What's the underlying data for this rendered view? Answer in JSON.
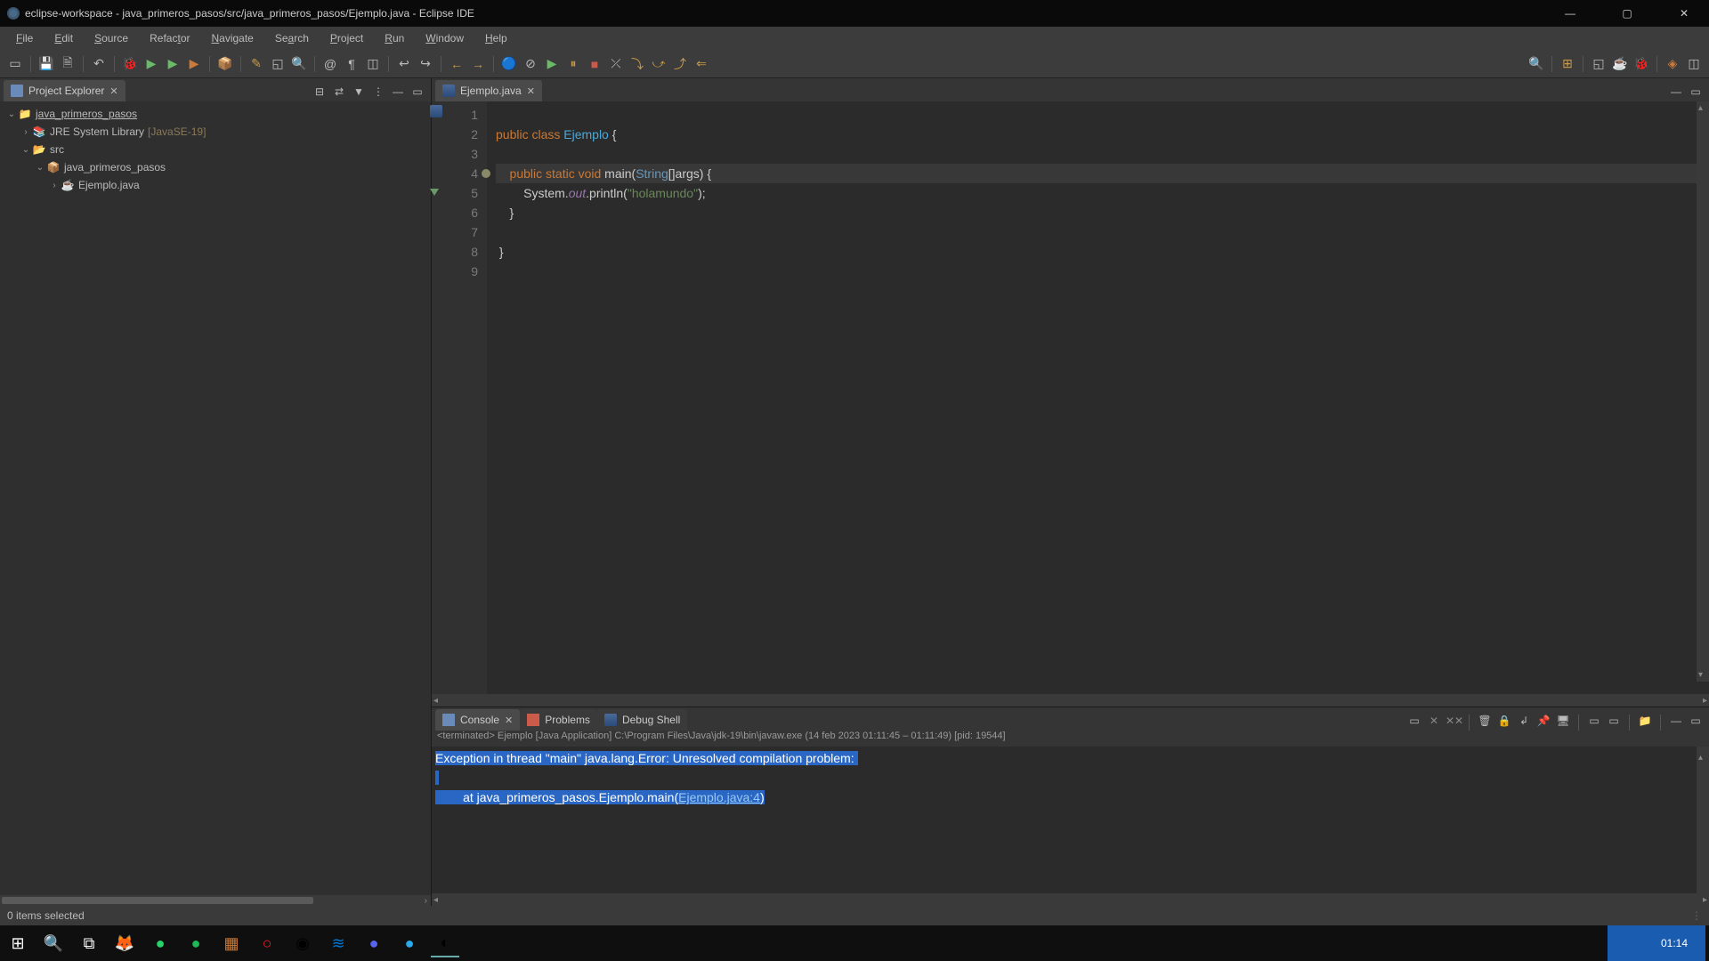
{
  "window_title": "eclipse-workspace - java_primeros_pasos/src/java_primeros_pasos/Ejemplo.java - Eclipse IDE",
  "menu": [
    "File",
    "Edit",
    "Source",
    "Refactor",
    "Navigate",
    "Search",
    "Project",
    "Run",
    "Window",
    "Help"
  ],
  "sidebar_tab": "Project Explorer",
  "tree": {
    "project": "java_primeros_pasos",
    "jre": "JRE System Library",
    "jre_ver": "[JavaSE-19]",
    "src": "src",
    "pkg": "java_primeros_pasos",
    "file": "Ejemplo.java"
  },
  "editor_tab": "Ejemplo.java",
  "code_lines": {
    "l1": "",
    "l2a": "public class ",
    "l2b": "Ejemplo",
    "l2c": " {",
    "l3": "",
    "l4a": "    public static void ",
    "l4b": "main",
    "l4c": "(",
    "l4d": "String",
    "l4e": "[]args) {",
    "l5a": "        System.",
    "l5b": "out",
    "l5c": ".println(",
    "l5d": "\"holamundo\"",
    "l5e": ");",
    "l6": "    }",
    "l7": "",
    "l8": " }",
    "l9": ""
  },
  "line_numbers": [
    "1",
    "2",
    "3",
    "4",
    "5",
    "6",
    "7",
    "8",
    "9"
  ],
  "console": {
    "tab1": "Console",
    "tab2": "Problems",
    "tab3": "Debug Shell",
    "status": "<terminated> Ejemplo [Java Application] C:\\Program Files\\Java\\jdk-19\\bin\\javaw.exe (14 feb 2023 01:11:45 – 01:11:49) [pid: 19544]",
    "line1": "Exception in thread \"main\" java.lang.Error: Unresolved compilation problem: ",
    "line2a": "        at java_primeros_pasos.Ejemplo.main(",
    "line2b": "Ejemplo.java:4",
    "line2c": ")"
  },
  "statusbar": "0 items selected",
  "clock": "01:14"
}
